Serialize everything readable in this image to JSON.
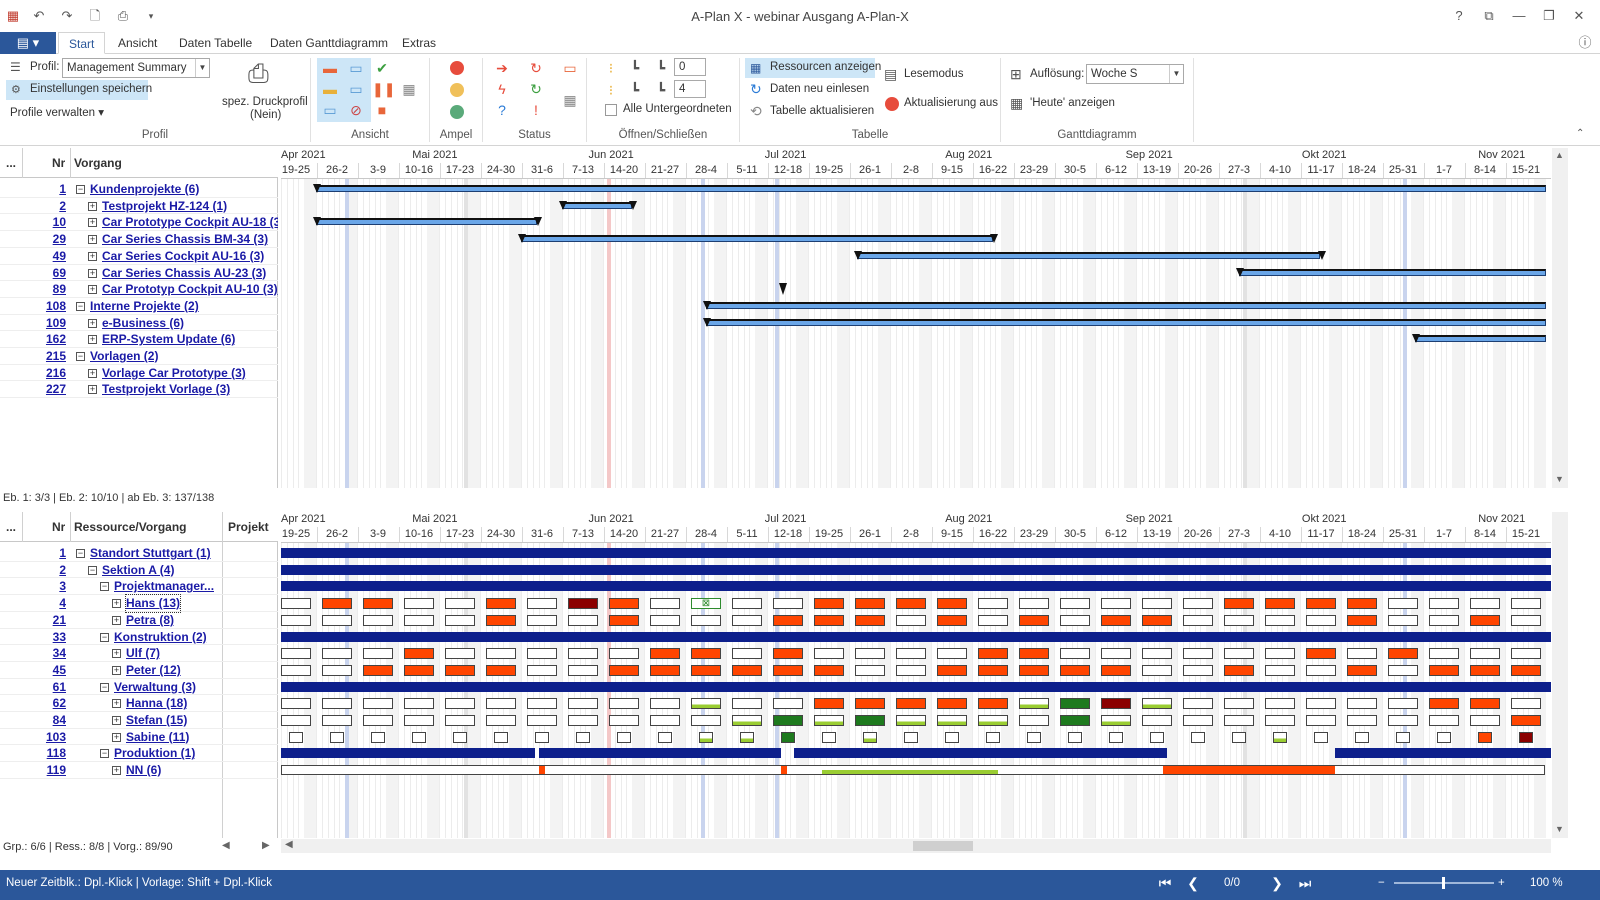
{
  "window": {
    "title": "A-Plan X - webinar Ausgang A-Plan-X",
    "help": "?",
    "restore_ribbon": "⧉",
    "minimize": "—",
    "maximize": "❐",
    "close": "✕"
  },
  "menu": {
    "file_label": "▤ ▾",
    "tabs": [
      "Start",
      "Ansicht",
      "Daten Tabelle",
      "Daten Ganttdiagramm",
      "Extras"
    ],
    "active_tab": "Start",
    "info": "ⓘ"
  },
  "ribbon": {
    "profil_label": "Profil:",
    "profil_value": "Management Summary",
    "save_settings": "Einstellungen speichern",
    "manage_profiles": "Profile verwalten ▾",
    "print_profile_line1": "spez. Druckprofil",
    "print_profile_line2": "(Nein)",
    "group_profil": "Profil",
    "group_ansicht": "Ansicht",
    "group_ampel": "Ampel",
    "group_status": "Status",
    "group_oeffnen": "Öffnen/Schließen",
    "spin1": "0",
    "spin2": "4",
    "alle_untergeordneten": "Alle Untergeordneten",
    "group_tabelle": "Tabelle",
    "ressourcen_anzeigen": "Ressourcen anzeigen",
    "daten_neu_einlesen": "Daten neu einlesen",
    "tabelle_aktualisieren": "Tabelle aktualisieren",
    "lesemodus": "Lesemodus",
    "aktualisierung_aus": "Aktualisierung aus",
    "aufloesung_label": "Auflösung:",
    "aufloesung_value": "Woche S",
    "heute_anzeigen": "'Heute' anzeigen",
    "group_gantt": "Ganttdiagramm"
  },
  "colors": {
    "accent": "#2b579a",
    "gantt_bar": "#6aa6e8",
    "resource_bar": "#0d1f8c",
    "load_orange": "#ff4500",
    "load_darkred": "#8b0000",
    "load_green": "#9acd32",
    "load_darkgreen": "#1e7a1e"
  },
  "timeline": {
    "months": [
      "Apr 2021",
      "Mai 2021",
      "Jun 2021",
      "Jul 2021",
      "Aug 2021",
      "Sep 2021",
      "Okt 2021",
      "Nov 2021"
    ],
    "weeks": [
      "19-25",
      "26-2",
      "3-9",
      "10-16",
      "17-23",
      "24-30",
      "31-6",
      "7-13",
      "14-20",
      "21-27",
      "28-4",
      "5-11",
      "12-18",
      "19-25",
      "26-1",
      "2-8",
      "9-15",
      "16-22",
      "23-29",
      "30-5",
      "6-12",
      "13-19",
      "20-26",
      "27-3",
      "4-10",
      "11-17",
      "18-24",
      "25-31",
      "1-7",
      "8-14",
      "15-21"
    ]
  },
  "top_table": {
    "col_dots": "...",
    "col_nr": "Nr",
    "col_vorgang": "Vorgang",
    "rows": [
      {
        "nr": "1",
        "label": "Kundenprojekte (6)",
        "level": 0,
        "toggle": "−"
      },
      {
        "nr": "2",
        "label": "Testprojekt HZ-124 (1)",
        "level": 1,
        "toggle": "+"
      },
      {
        "nr": "10",
        "label": "Car Prototype Cockpit AU-18 (3)",
        "level": 1,
        "toggle": "+"
      },
      {
        "nr": "29",
        "label": "Car Series Chassis BM-34 (3)",
        "level": 1,
        "toggle": "+"
      },
      {
        "nr": "49",
        "label": "Car Series Cockpit AU-16 (3)",
        "level": 1,
        "toggle": "+"
      },
      {
        "nr": "69",
        "label": "Car Series Chassis AU-23 (3)",
        "level": 1,
        "toggle": "+"
      },
      {
        "nr": "89",
        "label": "Car Prototyp Cockpit AU-10 (3)",
        "level": 1,
        "toggle": "+"
      },
      {
        "nr": "108",
        "label": "Interne Projekte (2)",
        "level": 0,
        "toggle": "−"
      },
      {
        "nr": "109",
        "label": "e-Business (6)",
        "level": 1,
        "toggle": "+"
      },
      {
        "nr": "162",
        "label": "ERP-System Update (6)",
        "level": 1,
        "toggle": "+"
      },
      {
        "nr": "215",
        "label": "Vorlagen (2)",
        "level": 0,
        "toggle": "−"
      },
      {
        "nr": "216",
        "label": "Vorlage Car Prototype (3)",
        "level": 1,
        "toggle": "+"
      },
      {
        "nr": "227",
        "label": "Testprojekt Vorlage (3)",
        "level": 1,
        "toggle": "+"
      }
    ]
  },
  "top_gantt_bars": [
    {
      "row": 0,
      "start": 1,
      "end": 31
    },
    {
      "row": 1,
      "start": 7,
      "end": 8.7
    },
    {
      "row": 2,
      "start": 1,
      "end": 6.4
    },
    {
      "row": 3,
      "start": 6,
      "end": 17.5
    },
    {
      "row": 4,
      "start": 14.2,
      "end": 25.5
    },
    {
      "row": 5,
      "start": 23.5,
      "end": 31
    },
    {
      "row": 7,
      "start": 10.5,
      "end": 31
    },
    {
      "row": 8,
      "start": 10.5,
      "end": 31
    },
    {
      "row": 9,
      "start": 27.8,
      "end": 31
    }
  ],
  "mid_status": "Eb. 1: 3/3 | Eb. 2: 10/10 | ab Eb. 3: 137/138",
  "bottom_table": {
    "col_dots": "...",
    "col_nr": "Nr",
    "col_res": "Ressource/Vorgang",
    "col_proj": "Projekt",
    "rows": [
      {
        "nr": "1",
        "label": "Standort Stuttgart (1)",
        "level": 0,
        "toggle": "−",
        "type": "group"
      },
      {
        "nr": "2",
        "label": "Sektion A (4)",
        "level": 1,
        "toggle": "−",
        "type": "group"
      },
      {
        "nr": "3",
        "label": "Projektmanager...",
        "level": 2,
        "toggle": "−",
        "type": "group"
      },
      {
        "nr": "4",
        "label": "Hans (13)",
        "level": 3,
        "toggle": "+",
        "type": "person"
      },
      {
        "nr": "21",
        "label": "Petra (8)",
        "level": 3,
        "toggle": "+",
        "type": "person"
      },
      {
        "nr": "33",
        "label": "Konstruktion (2)",
        "level": 2,
        "toggle": "−",
        "type": "group"
      },
      {
        "nr": "34",
        "label": "Ulf (7)",
        "level": 3,
        "toggle": "+",
        "type": "person"
      },
      {
        "nr": "45",
        "label": "Peter (12)",
        "level": 3,
        "toggle": "+",
        "type": "person"
      },
      {
        "nr": "61",
        "label": "Verwaltung (3)",
        "level": 2,
        "toggle": "−",
        "type": "group"
      },
      {
        "nr": "62",
        "label": "Hanna (18)",
        "level": 3,
        "toggle": "+",
        "type": "person"
      },
      {
        "nr": "84",
        "label": "Stefan (15)",
        "level": 3,
        "toggle": "+",
        "type": "person"
      },
      {
        "nr": "103",
        "label": "Sabine (11)",
        "level": 3,
        "toggle": "+",
        "type": "person"
      },
      {
        "nr": "118",
        "label": "Produktion (1)",
        "level": 2,
        "toggle": "−",
        "type": "group"
      },
      {
        "nr": "119",
        "label": "NN (6)",
        "level": 3,
        "toggle": "+",
        "type": "person"
      }
    ]
  },
  "resource_fills": {
    "3": [
      [
        1,
        "o"
      ],
      [
        2,
        "o"
      ],
      [
        5,
        "o"
      ],
      [
        7,
        "d"
      ],
      [
        8,
        "o"
      ],
      [
        10,
        "x"
      ],
      [
        13,
        "o"
      ],
      [
        14,
        "o"
      ],
      [
        15,
        "o"
      ],
      [
        16,
        "o"
      ],
      [
        23,
        "o"
      ],
      [
        24,
        "o"
      ],
      [
        25,
        "o"
      ],
      [
        26,
        "o"
      ]
    ],
    "4": [
      [
        5,
        "o"
      ],
      [
        8,
        "o"
      ],
      [
        12,
        "o"
      ],
      [
        13,
        "o"
      ],
      [
        14,
        "o"
      ],
      [
        16,
        "o"
      ],
      [
        18,
        "o"
      ],
      [
        20,
        "o"
      ],
      [
        21,
        "o"
      ],
      [
        26,
        "o"
      ],
      [
        29,
        "o"
      ]
    ],
    "6": [
      [
        3,
        "o"
      ],
      [
        9,
        "o"
      ],
      [
        10,
        "o"
      ],
      [
        12,
        "o"
      ],
      [
        17,
        "o"
      ],
      [
        18,
        "o"
      ],
      [
        25,
        "o"
      ],
      [
        27,
        "o"
      ]
    ],
    "7": [
      [
        2,
        "o"
      ],
      [
        3,
        "o"
      ],
      [
        4,
        "o"
      ],
      [
        5,
        "o"
      ],
      [
        8,
        "o"
      ],
      [
        9,
        "o"
      ],
      [
        10,
        "o"
      ],
      [
        11,
        "o"
      ],
      [
        12,
        "o"
      ],
      [
        13,
        "o"
      ],
      [
        16,
        "o"
      ],
      [
        17,
        "o"
      ],
      [
        18,
        "o"
      ],
      [
        19,
        "o"
      ],
      [
        20,
        "o"
      ],
      [
        23,
        "o"
      ],
      [
        26,
        "o"
      ],
      [
        28,
        "o"
      ],
      [
        29,
        "o"
      ],
      [
        30,
        "o"
      ]
    ],
    "9": [
      [
        10,
        "g"
      ],
      [
        13,
        "o"
      ],
      [
        14,
        "o"
      ],
      [
        15,
        "o"
      ],
      [
        16,
        "o"
      ],
      [
        17,
        "o"
      ],
      [
        18,
        "g"
      ],
      [
        19,
        "G"
      ],
      [
        20,
        "d"
      ],
      [
        21,
        "g"
      ],
      [
        28,
        "o"
      ],
      [
        29,
        "o"
      ]
    ],
    "10": [
      [
        11,
        "g"
      ],
      [
        12,
        "G"
      ],
      [
        13,
        "g"
      ],
      [
        14,
        "G"
      ],
      [
        15,
        "g"
      ],
      [
        16,
        "g"
      ],
      [
        17,
        "g"
      ],
      [
        19,
        "G"
      ],
      [
        20,
        "g"
      ],
      [
        30,
        "o"
      ]
    ],
    "11": [
      [
        10,
        "g"
      ],
      [
        11,
        "g"
      ],
      [
        12,
        "G"
      ],
      [
        14,
        "g"
      ],
      [
        24,
        "g"
      ],
      [
        29,
        "o"
      ],
      [
        30,
        "d"
      ]
    ]
  },
  "scroll": {
    "bottom_left_status": "Grp.: 6/6 | Ress.: 8/8 | Vorg.: 89/90"
  },
  "bottombar": {
    "hint": "Neuer Zeitblk.: Dpl.-Klick | Vorlage: Shift + Dpl.-Klick",
    "page": "0/0",
    "zoom": "100 %"
  }
}
